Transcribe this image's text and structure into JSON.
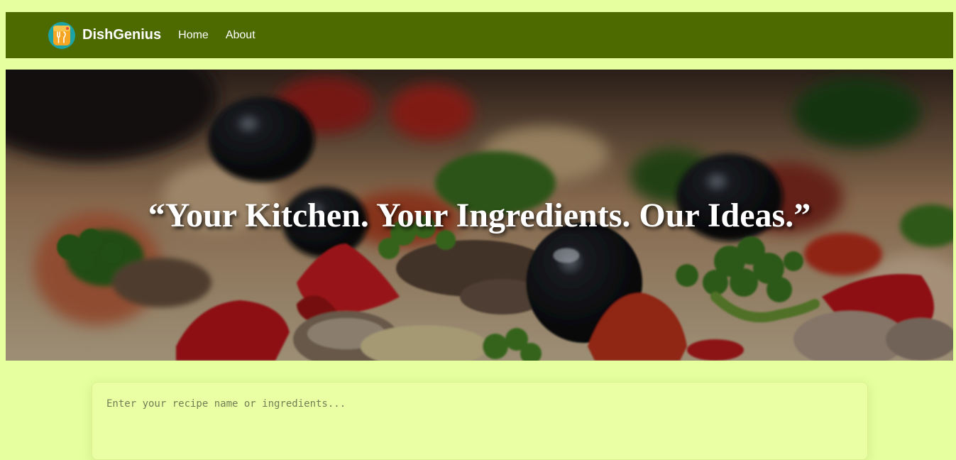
{
  "nav": {
    "brand": "DishGenius",
    "logo_icon": "chef-fork-icon",
    "links": [
      {
        "label": "Home"
      },
      {
        "label": "About"
      }
    ],
    "bg_color": "#4d6a00"
  },
  "hero": {
    "quote": "“Your Kitchen. Your Ingredients. Our Ideas.”",
    "image": "pizza-toppings-photo"
  },
  "search": {
    "placeholder": "Enter your recipe name or ingredients...",
    "value": ""
  },
  "colors": {
    "page_bg": "#e6ff9f",
    "accent": "#4d6a00"
  }
}
